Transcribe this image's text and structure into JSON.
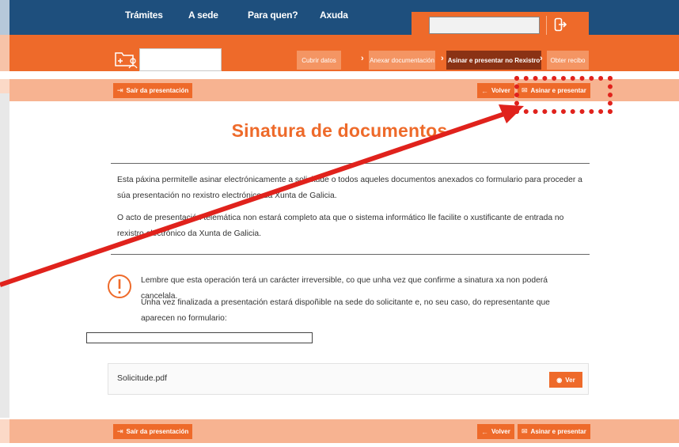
{
  "nav": {
    "items": [
      "Trámites",
      "A sede",
      "Para quen?",
      "Axuda"
    ]
  },
  "steps": [
    {
      "label": "Cubrir datos",
      "active": false
    },
    {
      "label": "Anexar documentación",
      "active": false
    },
    {
      "label": "Asinar e presentar no Rexistro",
      "active": true
    },
    {
      "label": "Obter recibo",
      "active": false
    }
  ],
  "actions": {
    "exit": "Saír da presentación",
    "back": "Volver",
    "sign": "Asinar e presentar"
  },
  "main": {
    "title": "Sinatura de documentos",
    "intro1": "Esta páxina permitelle asinar electrónicamente a solicitude o todos aqueles documentos anexados co formulario para proceder a súa presentación no rexistro electrónico da Xunta de Galicia.",
    "intro2": "O acto de presentación telemática non estará completo ata que o sistema informático lle facilite o xustificante de entrada no rexistro electrónico da Xunta de Galicia.",
    "warning1": "Lembre que esta operación terá un carácter irreversible, co que unha vez que confirme a sinatura xa non poderá cancelala.",
    "warning2": "Unha vez finalizada a presentación estará dispoñible na sede do solicitante e, no seu caso, do representante que aparecen no formulario:"
  },
  "file": {
    "name": "Solicitude.pdf",
    "view_label": "Ver"
  },
  "colors": {
    "nav_blue": "#1e4f7d",
    "brand_orange": "#ee6a2a",
    "annotation_red": "#e0221c"
  }
}
